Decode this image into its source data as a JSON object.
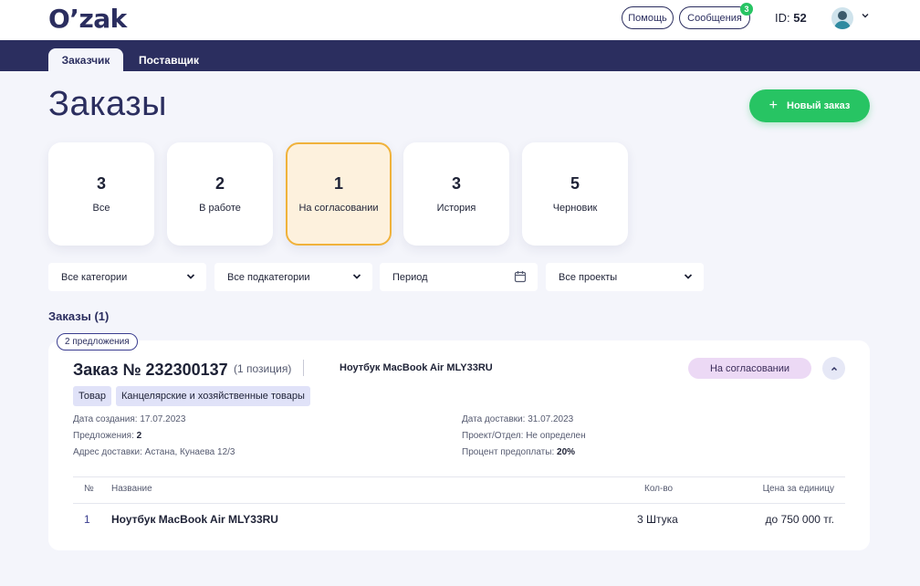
{
  "header": {
    "logo": "O’zak",
    "help_label": "Помощь",
    "messages_label": "Сообщения",
    "messages_count": "3",
    "id_label": "ID:",
    "id_value": "52"
  },
  "nav": {
    "tabs": [
      {
        "label": "Заказчик",
        "active": true
      },
      {
        "label": "Поставщик",
        "active": false
      }
    ]
  },
  "page": {
    "title": "Заказы",
    "new_order_label": "Новый заказ"
  },
  "status_cards": [
    {
      "count": "3",
      "label": "Все",
      "active": false
    },
    {
      "count": "2",
      "label": "В работе",
      "active": false
    },
    {
      "count": "1",
      "label": "На согласовании",
      "active": true
    },
    {
      "count": "3",
      "label": "История",
      "active": false
    },
    {
      "count": "5",
      "label": "Черновик",
      "active": false
    }
  ],
  "filters": {
    "category": "Все категории",
    "subcategory": "Все подкатегории",
    "period": "Период",
    "projects": "Все проекты"
  },
  "orders_section": {
    "title": "Заказы (1)"
  },
  "order": {
    "offers_badge": "2 предложения",
    "title": "Заказ № 232300137",
    "positions": "(1 позиция)",
    "product": "Ноутбук MacBook Air MLY33RU",
    "status": "На согласовании",
    "tags": [
      "Товар",
      "Канцелярские и хозяйственные товары"
    ],
    "created_label": "Дата создания:",
    "created_value": "17.07.2023",
    "offers_label": "Предложения:",
    "offers_value": "2",
    "address_label": "Адрес доставки:",
    "address_value": "Астана, Кунаева 12/3",
    "delivery_label": "Дата доставки:",
    "delivery_value": "31.07.2023",
    "project_label": "Проект/Отдел:",
    "project_value": "Не определен",
    "prepay_label": "Процент предоплаты:",
    "prepay_value": "20%",
    "table": {
      "headers": {
        "num": "№",
        "name": "Название",
        "qty": "Кол-во",
        "price": "Цена за единицу"
      },
      "rows": [
        {
          "num": "1",
          "name": "Ноутбук MacBook Air MLY33RU",
          "qty": "3 Штука",
          "price": "до 750 000 тг."
        }
      ]
    }
  },
  "colors": {
    "brand_navy": "#2b2e5f",
    "accent_green": "#27c463",
    "active_card_border": "#f0b23b",
    "status_pill_bg": "#ecd9f5"
  }
}
